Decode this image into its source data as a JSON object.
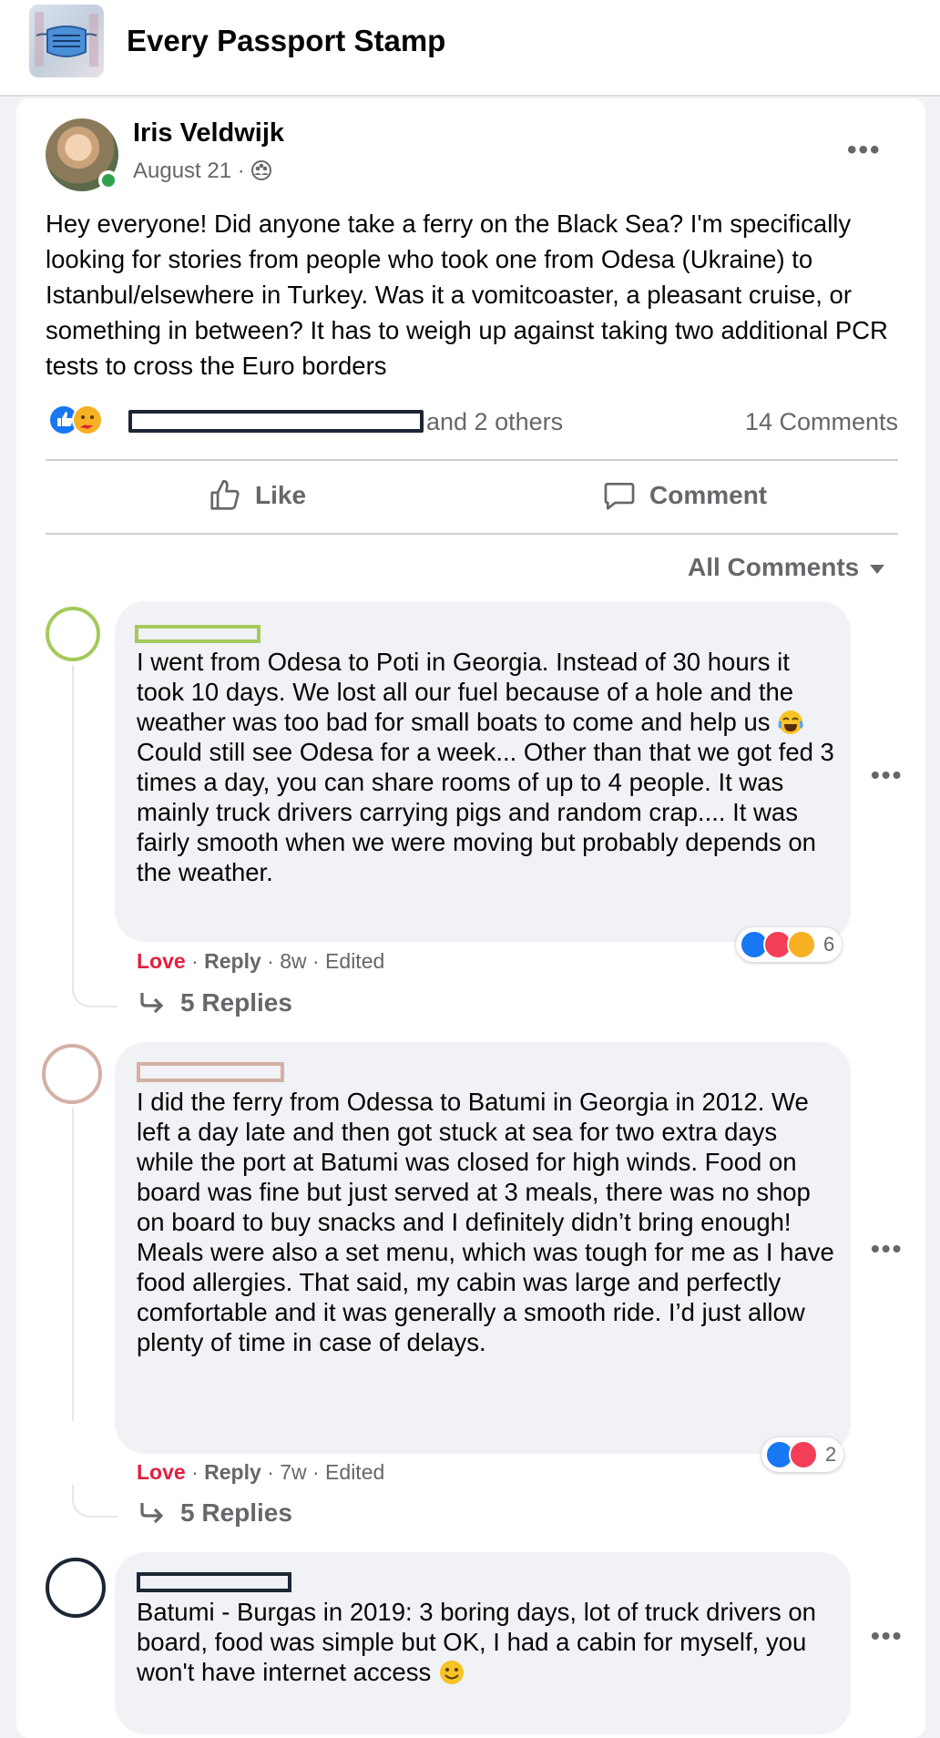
{
  "group": {
    "name": "Every Passport Stamp",
    "thumb_icon": "face-mask-icon"
  },
  "post": {
    "author": "Iris Veldwijk",
    "date": "August 21 · ",
    "audience_icon": "members-icon",
    "more_icon": "more-options-icon",
    "text": "Hey everyone! Did anyone take a ferry on the Black Sea? I'm specifically looking for stories from people who took one from Odesa (Ukraine) to Istanbul/elsewhere in Turkey. Was it a vomitcoaster, a pleasant cruise, or something in between? It has to weigh up against taking two additional PCR tests to cross the Euro borders",
    "reactors_suffix": "and 2 others",
    "comments_count": "14 Comments",
    "like_label": "Like",
    "comment_label": "Comment"
  },
  "filter_label": "All Comments",
  "colors": {
    "love": "#e41e3f",
    "online": "#31a24c",
    "like_blue": "#1877f2",
    "avatar_ring_1": "#a4c95a",
    "avatar_ring_2": "#d4b0a4",
    "avatar_ring_3": "#1c2634"
  },
  "comments": [
    {
      "text_before": "I went from Odesa to Poti in Georgia. Instead of 30 hours it took 10 days. We lost all our fuel because of a hole and the weather was too bad for small boats to come and help us ",
      "emoji": "laughing-crying-emoji",
      "text_after": " Could still see Odesa for a week... Other than that we got fed 3 times a day, you can share rooms of up to 4 people. It was mainly truck drivers carrying pigs and random crap.... It was fairly smooth when we were moving but probably depends on the weather.",
      "love": "Love",
      "reply": "Reply",
      "meta": " · 8w · Edited",
      "reaction_count": "6",
      "replies": "5 Replies"
    },
    {
      "text_before": "I did the ferry from Odessa to Batumi in Georgia in 2012. We left a day late and then got stuck at sea for two extra days while the port at Batumi was closed for high winds. Food on board was fine but just served at 3 meals, there was no shop on board to buy snacks and I definitely didn’t bring enough! Meals were also a set menu, which was tough for me as I have food allergies. That said, my cabin was large and perfectly comfortable and it was generally a smooth ride. I’d just allow plenty of time in case of delays.",
      "text_after": "",
      "love": "Love",
      "reply": "Reply",
      "meta": " · 7w · Edited",
      "reaction_count": "2",
      "replies": "5 Replies"
    },
    {
      "text_before": "Batumi - Burgas in 2019: 3 boring days, lot of truck drivers on board, food was simple but OK, I had a cabin for myself, you won't have internet access ",
      "emoji": "smile-emoji",
      "text_after": ""
    }
  ]
}
